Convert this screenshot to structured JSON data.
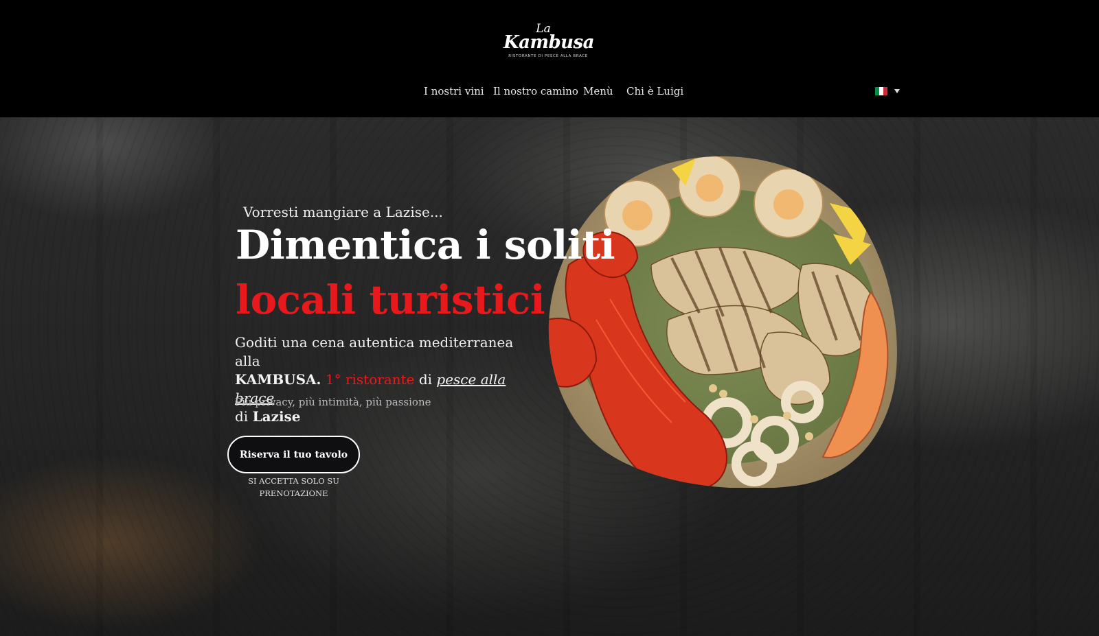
{
  "header": {
    "logo": {
      "script_small": "La",
      "script_name": "Kambusa",
      "subtitle": "RISTORANTE DI PESCE ALLA BRACE"
    },
    "nav": [
      {
        "label": "I nostri vini"
      },
      {
        "label": "Il nostro camino"
      },
      {
        "label": "Menù"
      },
      {
        "label": "Chi è Luigi"
      }
    ],
    "language": {
      "icon": "italian-flag-icon",
      "colors": [
        "#009246",
        "#ffffff",
        "#ce2b37"
      ]
    }
  },
  "hero": {
    "eyebrow": "Vorresti mangiare a Lazise...",
    "title_line1": "Dimentica i soliti",
    "title_line2": "locali turistici",
    "description": {
      "part1": "Goditi una cena autentica mediterranea alla",
      "brand": "KAMBUSA.",
      "highlight": "1° ristorante",
      "part2": "di",
      "link": "pesce alla brace",
      "part3": "di",
      "city": "Lazise"
    },
    "tagline": "Più privacy, più intimità, più passione",
    "cta_label": "Riserva il tuo tavolo",
    "cta_note": "SI ACCETTA SOLO SU PRENOTAZIONE",
    "image_alt": "grilled-seafood-platter"
  },
  "colors": {
    "accent_red": "#e8191c",
    "header_bg": "#000000",
    "button_bg": "#0f0f12"
  }
}
